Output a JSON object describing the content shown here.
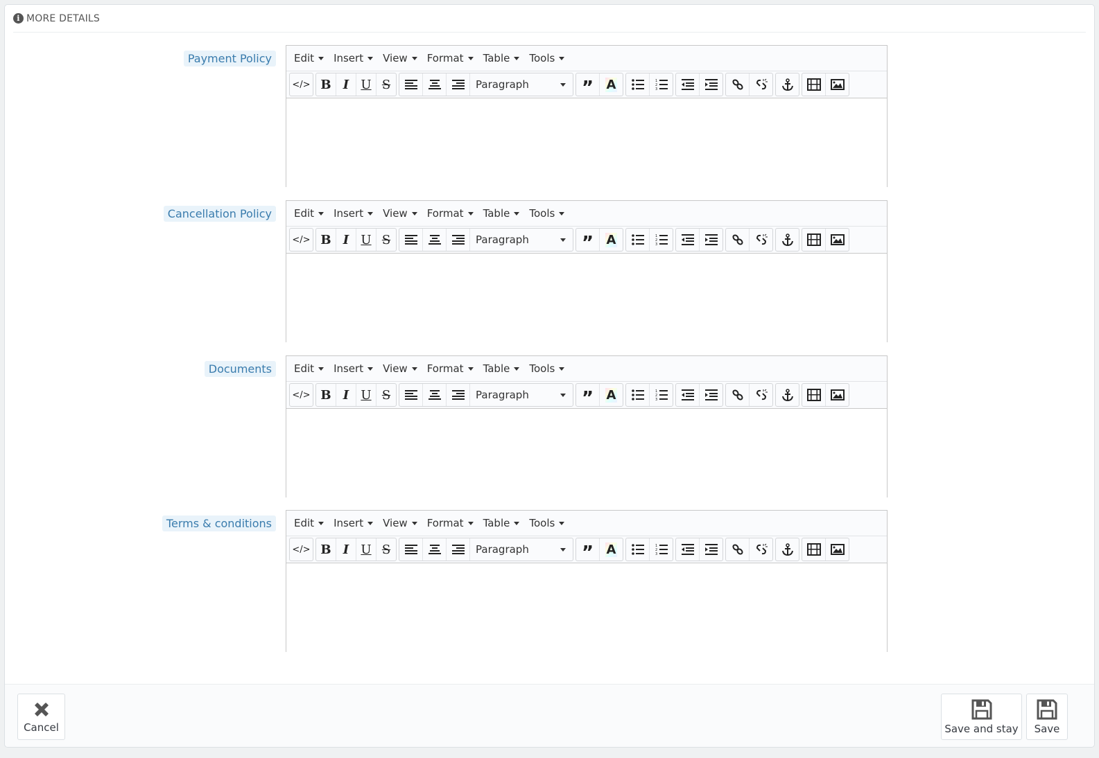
{
  "panel": {
    "heading": "MORE DETAILS",
    "heading_icon": "info-circle-icon"
  },
  "editor_menu": [
    "Edit",
    "Insert",
    "View",
    "Format",
    "Table",
    "Tools"
  ],
  "editor_toolbar": {
    "format_select_value": "Paragraph",
    "buttons": [
      "source-code",
      "bold",
      "italic",
      "underline",
      "strikethrough",
      "align-left",
      "align-center",
      "align-right",
      "blockquote",
      "text-color",
      "bullet-list",
      "numbered-list",
      "outdent",
      "indent",
      "link",
      "unlink",
      "anchor",
      "media",
      "image"
    ]
  },
  "fields": [
    {
      "label": "Payment Policy",
      "value": ""
    },
    {
      "label": "Cancellation Policy",
      "value": ""
    },
    {
      "label": "Documents",
      "value": ""
    },
    {
      "label": "Terms & conditions",
      "value": ""
    }
  ],
  "footer": {
    "cancel_label": "Cancel",
    "save_and_stay_label": "Save and stay",
    "save_label": "Save"
  }
}
